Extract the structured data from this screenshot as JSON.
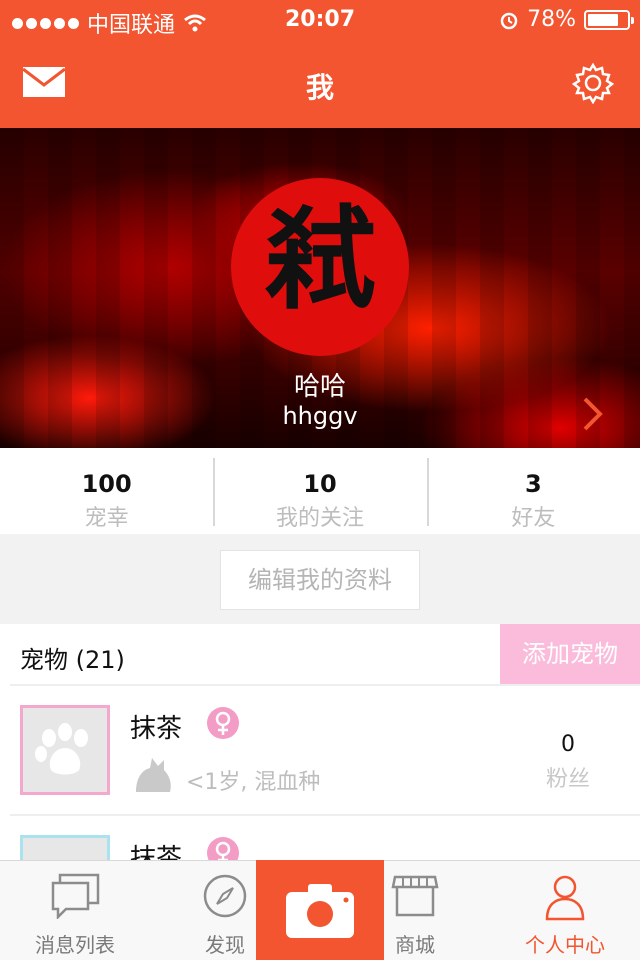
{
  "status_bar": {
    "carrier": "中国联通",
    "time": "20:07",
    "battery_text": "78%",
    "battery_level": 0.78
  },
  "nav": {
    "title": "我"
  },
  "profile": {
    "avatar_glyph": "弒",
    "display_name": "哈哈",
    "username": "hhggv"
  },
  "stats": [
    {
      "value": "100",
      "label": "宠幸"
    },
    {
      "value": "10",
      "label": "我的关注"
    },
    {
      "value": "3",
      "label": "好友"
    }
  ],
  "edit_profile_label": "编辑我的资料",
  "pets": {
    "title": "宠物 (21)",
    "add_label": "添加宠物",
    "items": [
      {
        "name": "抹茶",
        "meta": "<1岁, 混血种",
        "fans": "0",
        "fans_label": "粉丝"
      },
      {
        "name": "抹茶",
        "meta": "",
        "fans": "",
        "fans_label": ""
      }
    ]
  },
  "tabbar": {
    "messages": "消息列表",
    "discover": "发现",
    "shop": "商城",
    "profile": "个人中心"
  },
  "colors": {
    "accent": "#f2552f",
    "pink": "#fbbcdc",
    "muted": "#bdbdbd"
  },
  "icons": [
    "wifi-icon",
    "alarm-icon",
    "mail-icon",
    "gear-icon",
    "chevron-right-icon",
    "female-icon",
    "cat-icon",
    "paw-icon",
    "chat-icon",
    "compass-icon",
    "camera-icon",
    "store-icon",
    "person-icon"
  ]
}
